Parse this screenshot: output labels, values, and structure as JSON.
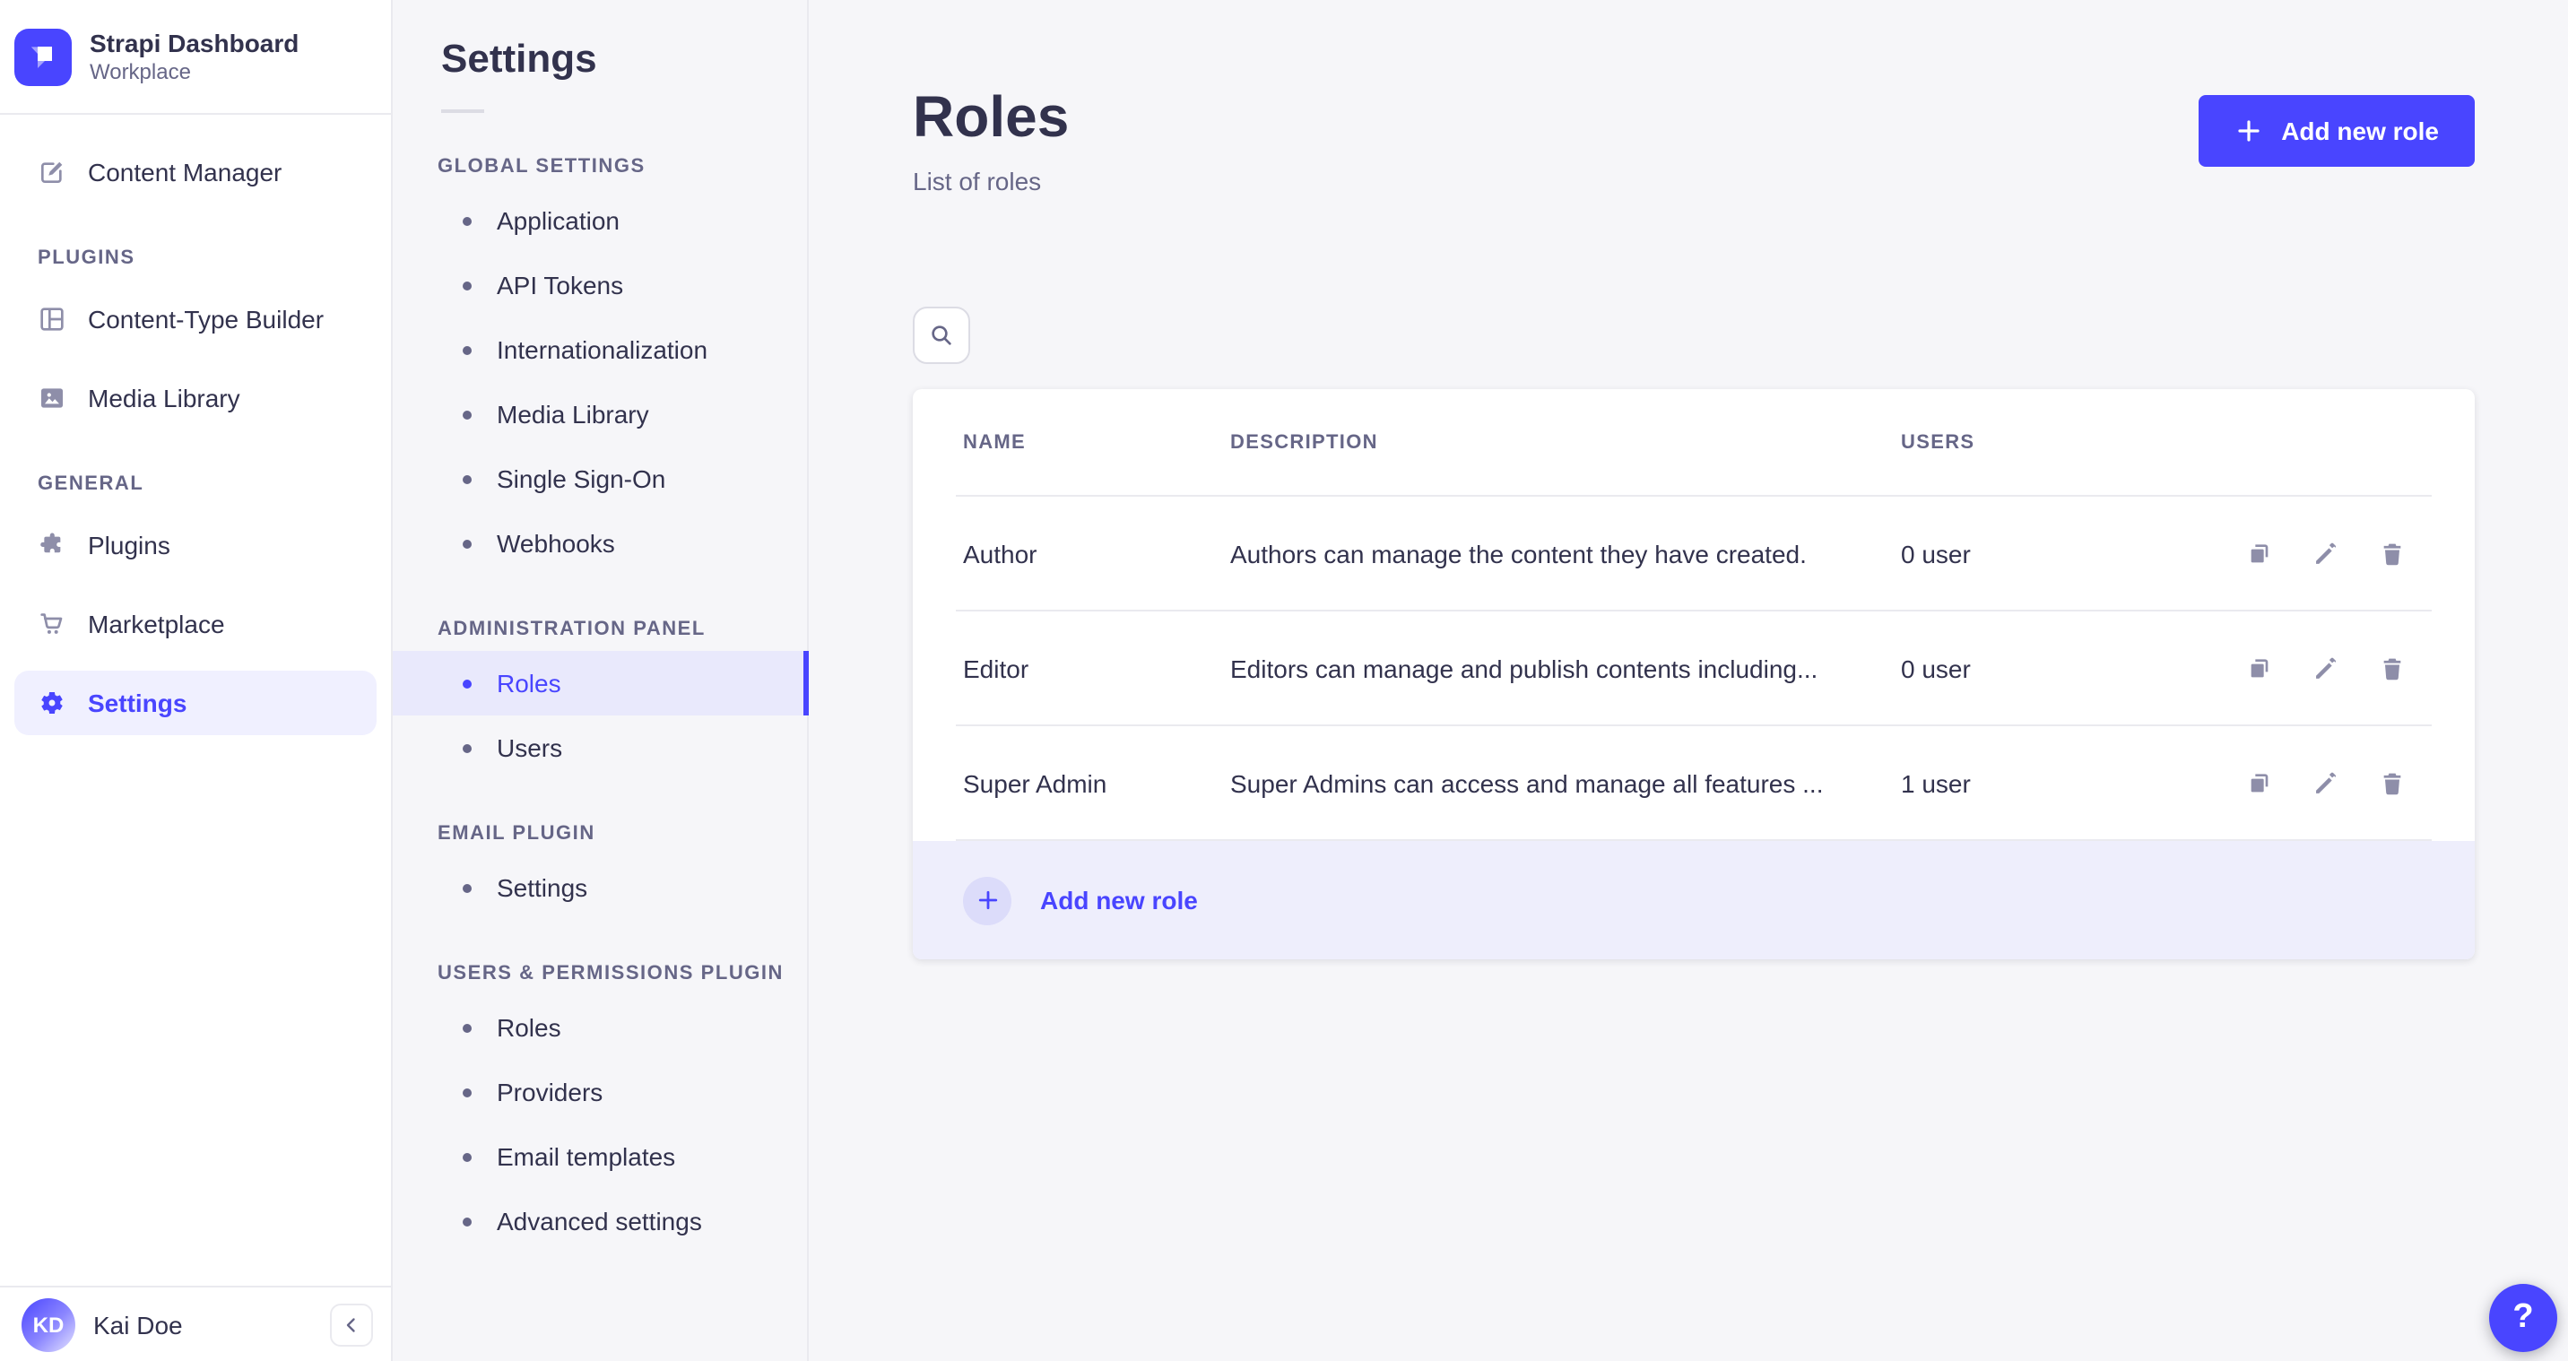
{
  "colors": {
    "accent": "#4945ff",
    "text_dark": "#32324d",
    "text_muted": "#666687",
    "icon_gray": "#8e8ea9",
    "border": "#eaeaef",
    "background": "#f6f6f9",
    "active_subnav_bg": "#e9e9fc",
    "footer_row_bg": "#eeeefc"
  },
  "sidebar": {
    "app_title": "Strapi Dashboard",
    "app_subtitle": "Workplace",
    "content_manager_label": "Content Manager",
    "sections": [
      {
        "title": "PLUGINS",
        "items": [
          {
            "label": "Content-Type Builder"
          },
          {
            "label": "Media Library"
          }
        ]
      },
      {
        "title": "GENERAL",
        "items": [
          {
            "label": "Plugins"
          },
          {
            "label": "Marketplace"
          },
          {
            "label": "Settings",
            "active": true
          }
        ]
      }
    ],
    "user": {
      "initials": "KD",
      "name": "Kai Doe"
    }
  },
  "settings_nav": {
    "title": "Settings",
    "groups": [
      {
        "title": "GLOBAL SETTINGS",
        "items": [
          {
            "label": "Application"
          },
          {
            "label": "API Tokens"
          },
          {
            "label": "Internationalization"
          },
          {
            "label": "Media Library"
          },
          {
            "label": "Single Sign-On"
          },
          {
            "label": "Webhooks"
          }
        ]
      },
      {
        "title": "ADMINISTRATION PANEL",
        "items": [
          {
            "label": "Roles",
            "active": true
          },
          {
            "label": "Users"
          }
        ]
      },
      {
        "title": "EMAIL PLUGIN",
        "items": [
          {
            "label": "Settings"
          }
        ]
      },
      {
        "title": "USERS & PERMISSIONS PLUGIN",
        "items": [
          {
            "label": "Roles"
          },
          {
            "label": "Providers"
          },
          {
            "label": "Email templates"
          },
          {
            "label": "Advanced settings"
          }
        ]
      }
    ]
  },
  "main": {
    "title": "Roles",
    "subtitle": "List of roles",
    "add_button_label": "Add new role",
    "table": {
      "headers": {
        "name": "NAME",
        "description": "DESCRIPTION",
        "users": "USERS"
      },
      "rows": [
        {
          "name": "Author",
          "description": "Authors can manage the content they have created.",
          "users": "0 user"
        },
        {
          "name": "Editor",
          "description": "Editors can manage and publish contents including...",
          "users": "0 user"
        },
        {
          "name": "Super Admin",
          "description": "Super Admins can access and manage all features ...",
          "users": "1 user"
        }
      ],
      "footer_add_label": "Add new role"
    },
    "help_label": "?"
  },
  "icons": {
    "logo": "strapi-mark",
    "content_manager": "feather-pen",
    "content_type_builder": "layout-grid",
    "media_library": "picture",
    "plugins": "puzzle-piece",
    "marketplace": "shopping-cart",
    "settings": "gear",
    "search": "magnifier",
    "add": "plus",
    "row_actions": [
      "duplicate",
      "pencil",
      "trash"
    ],
    "collapse": "chevron-left",
    "help": "question-mark"
  }
}
